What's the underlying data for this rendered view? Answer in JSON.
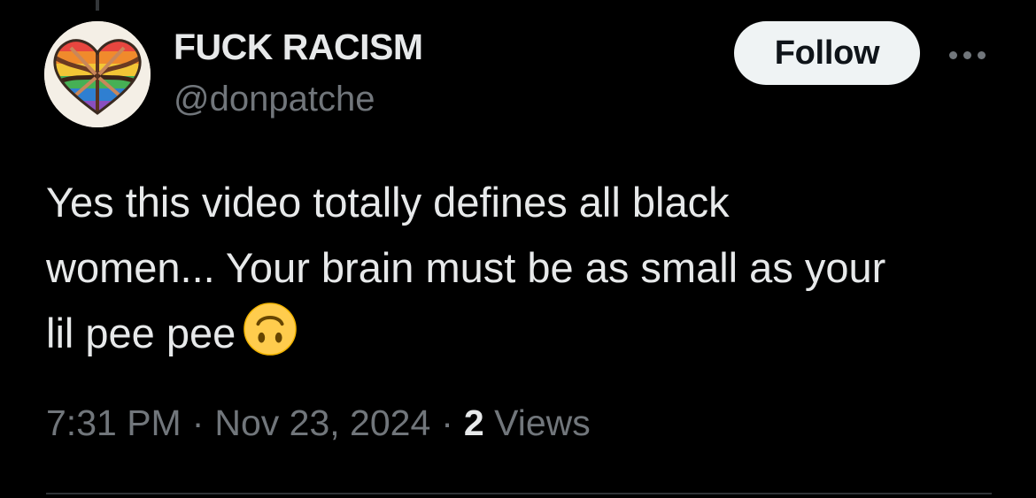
{
  "author": {
    "display_name": "FUCK RACISM",
    "handle": "@donpatche",
    "avatar_icon": "rainbow-heart-hands-icon"
  },
  "actions": {
    "follow_label": "Follow",
    "more_icon": "more-horizontal-icon"
  },
  "tweet": {
    "lines": [
      "Yes this video totally defines all black",
      "women... Your brain must be as small as your",
      "lil pee pee"
    ],
    "emoji": "upside-down-face-emoji"
  },
  "meta": {
    "time": "7:31 PM",
    "date": "Nov 23, 2024",
    "views_count": "2",
    "views_label": "Views",
    "separator": "·"
  },
  "colors": {
    "background": "#000000",
    "primary_text": "#e7e9ea",
    "secondary_text": "#71767b",
    "follow_bg": "#eff3f4",
    "follow_text": "#0f1419"
  }
}
